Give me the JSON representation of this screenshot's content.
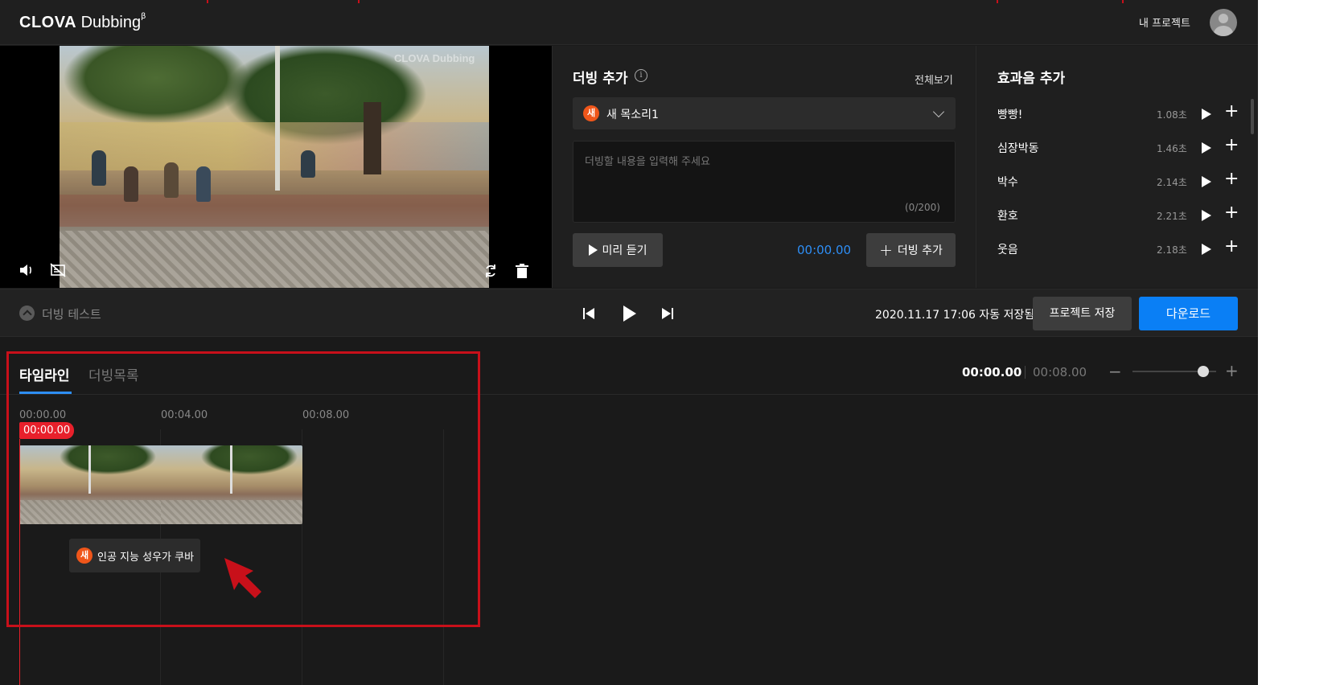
{
  "app": {
    "logo_bold": "CLOVA",
    "logo_light": " Dubbing",
    "logo_mark": "β",
    "my_projects": "내 프로젝트"
  },
  "video": {
    "watermark": "CLOVA Dubbing",
    "icons": [
      "volume-icon",
      "subtitle-off-icon",
      "replace-icon",
      "trash-icon"
    ]
  },
  "dubbing": {
    "title": "더빙 추가",
    "view_all": "전체보기",
    "voice_badge": "새",
    "voice_name": "새 목소리1",
    "text_placeholder": "더빙할 내용을 입력해 주세요",
    "char_count": "(0/200)",
    "preview_label": "미리 듣기",
    "time": "00:00.00",
    "add_label": "더빙 추가"
  },
  "effects": {
    "title": "효과음 추가",
    "items": [
      {
        "name": "빵빵!",
        "duration": "1.08초"
      },
      {
        "name": "심장박동",
        "duration": "1.46초"
      },
      {
        "name": "박수",
        "duration": "2.14초"
      },
      {
        "name": "환호",
        "duration": "2.21초"
      },
      {
        "name": "웃음",
        "duration": "2.18초"
      }
    ]
  },
  "transport": {
    "dub_test": "더빙 테스트",
    "autosave": "2020.11.17 17:06 자동 저장됨",
    "save_project": "프로젝트 저장",
    "download": "다운로드"
  },
  "timeline": {
    "tabs": [
      {
        "label": "타임라인",
        "active": true
      },
      {
        "label": "더빙목록",
        "active": false
      }
    ],
    "current_time": "00:00.00",
    "total_time": "00:08.00",
    "zoom_level": 0.85,
    "ticks": [
      "00:00.00",
      "00:04.00",
      "00:08.00"
    ],
    "playhead": "00:00.00",
    "chip_badge": "새",
    "chip_text": "인공 지능 성우가 쿠바"
  },
  "colors": {
    "accent_blue": "#0a7ff5",
    "playhead_red": "#e8202b",
    "new_badge_orange": "#f0561a",
    "annotation_red": "#c8101a"
  }
}
